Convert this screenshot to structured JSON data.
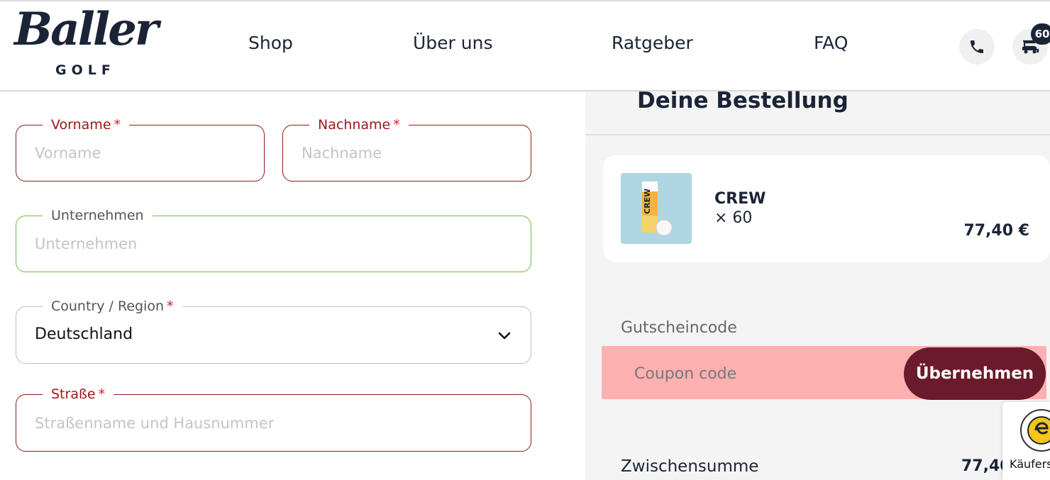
{
  "brand": {
    "logo_script": "Baller",
    "logo_sub": "GOLF"
  },
  "nav": [
    {
      "label": "Shop"
    },
    {
      "label": "Über uns"
    },
    {
      "label": "Ratgeber"
    },
    {
      "label": "FAQ"
    }
  ],
  "header_icons": {
    "phone": "phone-icon",
    "cart": "golf-cart-icon",
    "cart_count": "60"
  },
  "form": {
    "first_name": {
      "label": "Vorname",
      "required_mark": "*",
      "placeholder": "Vorname",
      "value": ""
    },
    "last_name": {
      "label": "Nachname",
      "required_mark": "*",
      "placeholder": "Nachname",
      "value": ""
    },
    "company": {
      "label": "Unternehmen",
      "placeholder": "Unternehmen",
      "value": ""
    },
    "country": {
      "label": "Country / Region",
      "required_mark": "*",
      "selected": "Deutschland"
    },
    "street": {
      "label": "Straße",
      "required_mark": "*",
      "placeholder": "Straßenname und Hausnummer",
      "value": ""
    }
  },
  "order": {
    "title": "Deine Bestellung",
    "item": {
      "name": "CREW",
      "quantity": "× 60",
      "price": "77,40 €",
      "thumb_text": "CREW"
    },
    "coupon": {
      "label": "Gutscheincode",
      "placeholder": "Coupon code",
      "apply_label": "Übernehmen"
    },
    "subtotal": {
      "label": "Zwischensumme",
      "value": "77,40"
    }
  },
  "trust": {
    "text": "Käufers"
  },
  "colors": {
    "navy": "#1b2436",
    "error_red": "#a11616",
    "valid_green": "#6fbe46",
    "button_burgundy": "#6b1a2b",
    "coupon_highlight": "#fdb0b0"
  }
}
